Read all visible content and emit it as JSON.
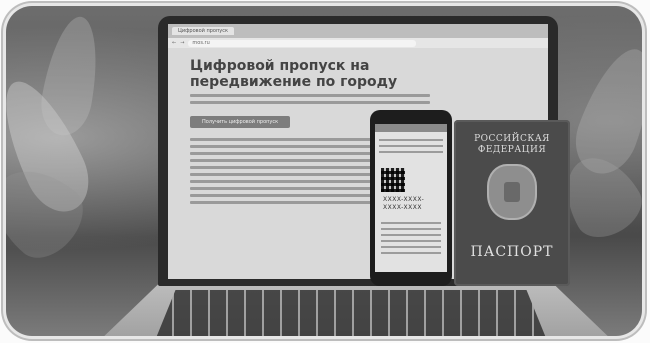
{
  "screen": {
    "tab_label": "Цифровой пропуск",
    "url": "mos.ru",
    "heading": "Цифровой пропуск на передвижение по городу",
    "button_label": "Получить цифровой пропуск"
  },
  "phone": {
    "code_line1": "XXXX-XXXX-",
    "code_line2": "XXXX-XXXX"
  },
  "passport": {
    "title": "РОССИЙСКАЯ ФЕДЕРАЦИЯ",
    "label": "ПАСПОРТ"
  }
}
